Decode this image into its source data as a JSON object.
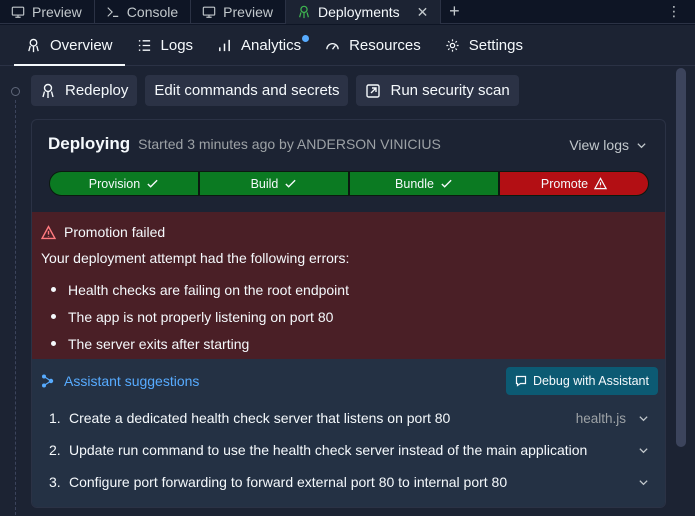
{
  "tabs": [
    {
      "label": "Preview",
      "icon": "monitor-icon"
    },
    {
      "label": "Console",
      "icon": "terminal-icon"
    },
    {
      "label": "Preview",
      "icon": "monitor-icon"
    },
    {
      "label": "Deployments",
      "icon": "deployments-icon",
      "active": true
    }
  ],
  "subnav": [
    {
      "label": "Overview",
      "icon": "deployments-icon",
      "active": true
    },
    {
      "label": "Logs",
      "icon": "list-icon"
    },
    {
      "label": "Analytics",
      "icon": "bar-chart-icon",
      "has_dot": true
    },
    {
      "label": "Resources",
      "icon": "gauge-icon"
    },
    {
      "label": "Settings",
      "icon": "gear-icon"
    }
  ],
  "actions": {
    "redeploy": "Redeploy",
    "edit": "Edit commands and secrets",
    "scan": "Run security scan"
  },
  "deployment": {
    "title": "Deploying",
    "subtitle": "Started 3 minutes ago by ANDERSON VINICIUS",
    "view_logs": "View logs",
    "stages": [
      {
        "label": "Provision",
        "status": "success"
      },
      {
        "label": "Build",
        "status": "success"
      },
      {
        "label": "Bundle",
        "status": "success"
      },
      {
        "label": "Promote",
        "status": "failed"
      }
    ]
  },
  "error": {
    "title": "Promotion failed",
    "lead": "Your deployment attempt had the following errors:",
    "items": [
      "Health checks are failing on the root endpoint",
      "The app is not properly listening on port 80",
      "The server exits after starting"
    ]
  },
  "assistant": {
    "title": "Assistant suggestions",
    "debug_button": "Debug with Assistant",
    "suggestions": [
      {
        "num": "1.",
        "text": "Create a dedicated health check server that listens on port 80",
        "file": "health.js"
      },
      {
        "num": "2.",
        "text": "Update run command to use the health check server instead of the main application",
        "file": ""
      },
      {
        "num": "3.",
        "text": "Configure port forwarding to forward external port 80 to internal port 80",
        "file": ""
      }
    ]
  },
  "colors": {
    "background": "#1c2333",
    "success": "#0b7a22",
    "failure": "#b30f14",
    "error_panel": "#4a1f26",
    "accent": "#57abff"
  }
}
